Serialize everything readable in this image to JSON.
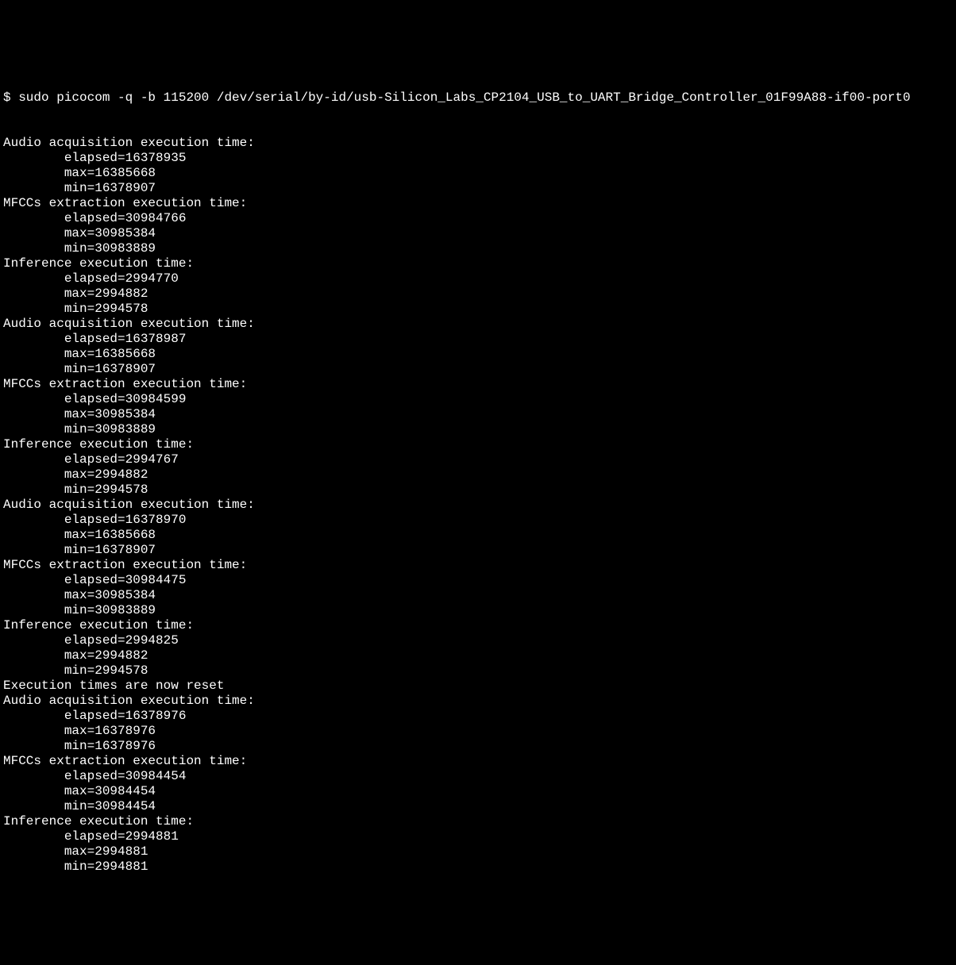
{
  "prompt": "$ ",
  "command": "sudo picocom -q -b 115200 /dev/serial/by-id/usb-Silicon_Labs_CP2104_USB_to_UART_Bridge_Controller_01F99A88-if00-port0",
  "indent": "        ",
  "labels": {
    "audio": "Audio acquisition execution time:",
    "mfcc": "MFCCs extraction execution time:",
    "inference": "Inference execution time:",
    "reset": "Execution times are now reset",
    "elapsed": "elapsed=",
    "max": "max=",
    "min": "min="
  },
  "blocks": [
    {
      "title_key": "audio",
      "elapsed": "16378935",
      "max": "16385668",
      "min": "16378907"
    },
    {
      "title_key": "mfcc",
      "elapsed": "30984766",
      "max": "30985384",
      "min": "30983889"
    },
    {
      "title_key": "inference",
      "elapsed": "2994770",
      "max": "2994882",
      "min": "2994578"
    },
    {
      "title_key": "audio",
      "elapsed": "16378987",
      "max": "16385668",
      "min": "16378907"
    },
    {
      "title_key": "mfcc",
      "elapsed": "30984599",
      "max": "30985384",
      "min": "30983889"
    },
    {
      "title_key": "inference",
      "elapsed": "2994767",
      "max": "2994882",
      "min": "2994578"
    },
    {
      "title_key": "audio",
      "elapsed": "16378970",
      "max": "16385668",
      "min": "16378907"
    },
    {
      "title_key": "mfcc",
      "elapsed": "30984475",
      "max": "30985384",
      "min": "30983889"
    },
    {
      "title_key": "inference",
      "elapsed": "2994825",
      "max": "2994882",
      "min": "2994578"
    },
    {
      "reset": true
    },
    {
      "title_key": "audio",
      "elapsed": "16378976",
      "max": "16378976",
      "min": "16378976"
    },
    {
      "title_key": "mfcc",
      "elapsed": "30984454",
      "max": "30984454",
      "min": "30984454"
    },
    {
      "title_key": "inference",
      "elapsed": "2994881",
      "max": "2994881",
      "min": "2994881"
    }
  ]
}
